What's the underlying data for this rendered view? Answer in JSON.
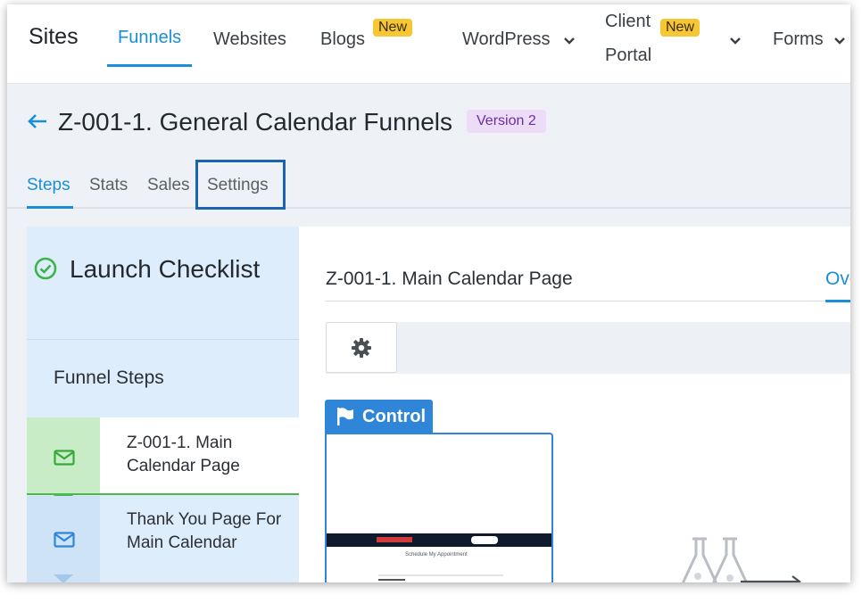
{
  "topnav": {
    "brand": "Sites",
    "items": [
      {
        "label": "Funnels"
      },
      {
        "label": "Websites"
      },
      {
        "label": "Blogs"
      },
      {
        "label": "WordPress"
      },
      {
        "label_line1": "Client",
        "label_line2": "Portal"
      },
      {
        "label": "Forms"
      }
    ],
    "badge_new": "New"
  },
  "header": {
    "title": "Z-001-1. General Calendar Funnels",
    "version": "Version 2",
    "tabs": [
      "Steps",
      "Stats",
      "Sales",
      "Settings"
    ]
  },
  "sidebar": {
    "launch_checklist": "Launch Checklist",
    "funnel_steps": "Funnel Steps",
    "steps": [
      {
        "label": "Z-001-1. Main Calendar Page"
      },
      {
        "label": "Thank You Page For Main Calendar"
      }
    ]
  },
  "main": {
    "title": "Z-001-1. Main Calendar Page",
    "overview_tab": "Ove",
    "control_label": "Control",
    "thumbnail_text": "Schedule My Appointment"
  },
  "colors": {
    "accent": "#1a8fd6",
    "badge": "#f6c633",
    "version_bg": "#ecdcf7",
    "step_active": "#4cb84c",
    "highlight_box": "#1c64b3"
  }
}
